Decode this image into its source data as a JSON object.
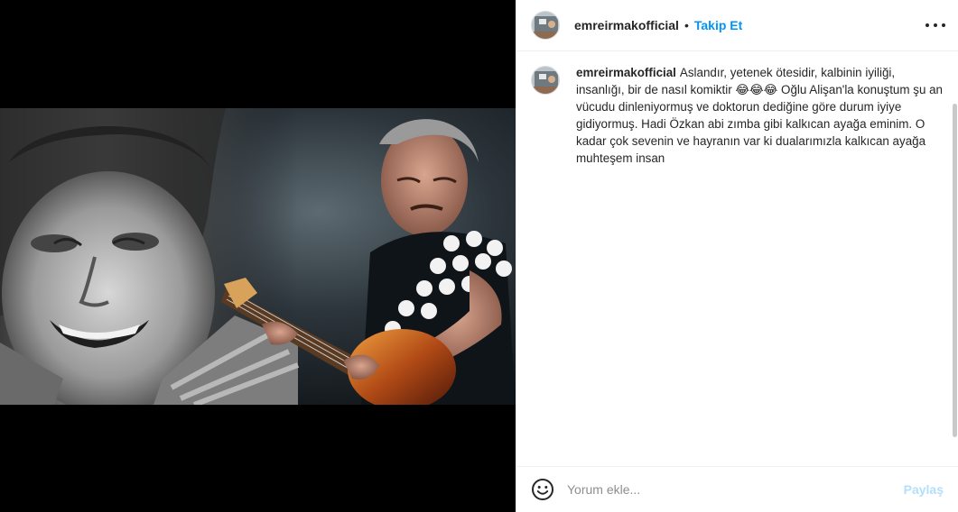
{
  "post": {
    "username": "emreirmakofficial",
    "separator": "•",
    "follow_label": "Takip Et",
    "more_icon": "more-options-icon"
  },
  "media": {
    "description_icon": "photo"
  },
  "caption": {
    "username": "emreirmakofficial",
    "text": "Aslandır, yetenek ötesidir, kalbinin iyiliği, insanlığı, bir de nasıl komiktir 😂😂😂 Oğlu Alişan'la konuştum şu an vücudu dinleniyormuş ve doktorun dediğine göre durum iyiye gidiyormuş. Hadi Özkan abi zımba gibi kalkıcan ayağa eminim. O kadar çok sevenin ve hayranın var ki dualarımızla kalkıcan ayağa muhteşem insan"
  },
  "composer": {
    "placeholder": "Yorum ekle...",
    "share_label": "Paylaş",
    "emoji_icon": "smiley-icon"
  },
  "colors": {
    "link": "#0095f6",
    "share_disabled": "#b2dffc",
    "text": "#262626",
    "muted": "#8e8e8e"
  }
}
